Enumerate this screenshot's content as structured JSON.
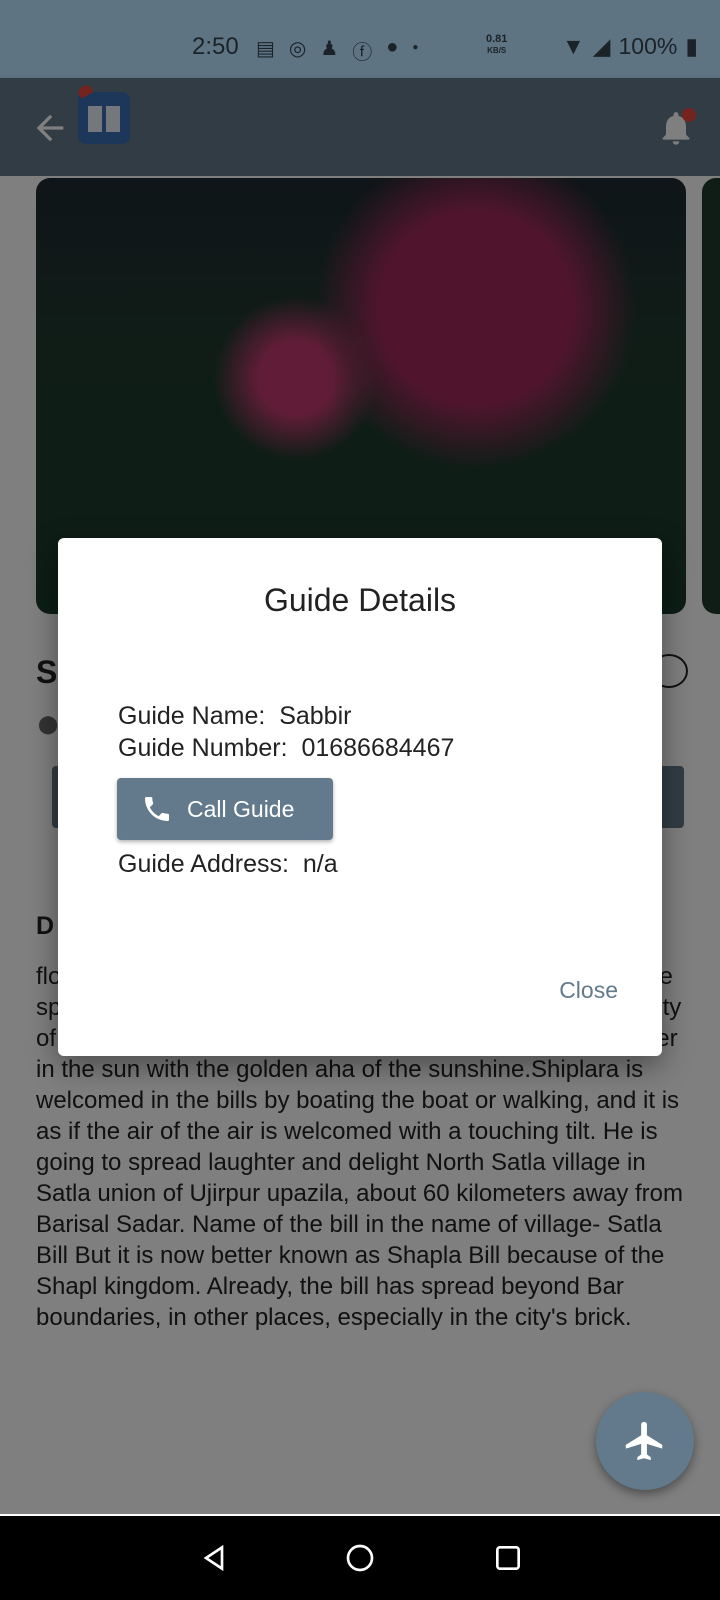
{
  "status_bar": {
    "time": "2:50",
    "network_speed_value": "0.81",
    "network_speed_unit": "KB/S",
    "battery": "100%"
  },
  "page": {
    "title_initial": "S",
    "description_heading_initial": "D",
    "description": "flower Shapla Bahari Beauty. Thousands of red shafas have sprouted in the water of weeds and coconut bills. The beauty of the bill has increased several times by reflecting the water in the sun with the golden aha of the sunshine.Shiplara is welcomed in the bills by boating the boat or walking, and it is as if the air of the air is welcomed with a touching tilt. He is going to spread laughter and delight North Satla village in Satla union of Ujirpur upazila, about 60 kilometers away from Barisal Sadar. Name of the bill in the name of village- Satla Bill But it is now better known as Shapla Bill because of the Shapl kingdom. Already, the bill has spread beyond Bar boundaries, in other places, especially in the city's brick."
  },
  "dialog": {
    "title": "Guide Details",
    "name_label": "Guide Name:",
    "name_value": "Sabbir",
    "number_label": "Guide Number:",
    "number_value": "01686684467",
    "call_label": "Call Guide",
    "address_label": "Guide Address:",
    "address_value": "n/a",
    "close_label": "Close"
  },
  "colors": {
    "accent": "#627a8b",
    "appbar": "#64798a",
    "notification": "#e8473c"
  }
}
